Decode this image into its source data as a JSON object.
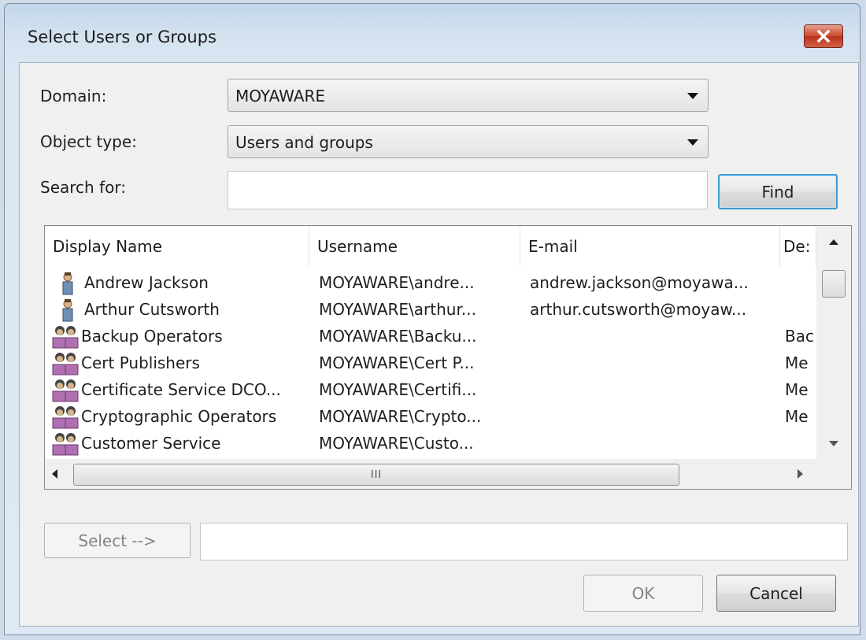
{
  "window": {
    "title": "Select Users or Groups"
  },
  "form": {
    "domain_label": "Domain:",
    "domain_value": "MOYAWARE",
    "object_type_label": "Object type:",
    "object_type_value": "Users and groups",
    "search_label": "Search for:",
    "search_value": "",
    "find_label": "Find"
  },
  "list": {
    "columns": [
      "Display Name",
      "Username",
      "E-mail",
      "De:"
    ],
    "rows": [
      {
        "icon": "user-icon",
        "name": "Andrew Jackson",
        "username": "MOYAWARE\\andre...",
        "email": "andrew.jackson@moyawa...",
        "desc": ""
      },
      {
        "icon": "user-icon",
        "name": "Arthur Cutsworth",
        "username": "MOYAWARE\\arthur...",
        "email": "arthur.cutsworth@moyaw...",
        "desc": ""
      },
      {
        "icon": "group-icon",
        "name": "Backup Operators",
        "username": "MOYAWARE\\Backu...",
        "email": "",
        "desc": "Bac"
      },
      {
        "icon": "group-icon",
        "name": "Cert Publishers",
        "username": "MOYAWARE\\Cert P...",
        "email": "",
        "desc": "Me"
      },
      {
        "icon": "group-icon",
        "name": "Certificate Service DCO...",
        "username": "MOYAWARE\\Certifi...",
        "email": "",
        "desc": "Me"
      },
      {
        "icon": "group-icon",
        "name": "Cryptographic Operators",
        "username": "MOYAWARE\\Crypto...",
        "email": "",
        "desc": "Me"
      },
      {
        "icon": "group-icon",
        "name": "Customer Service",
        "username": "MOYAWARE\\Custo...",
        "email": "",
        "desc": ""
      }
    ],
    "hscroll_grip": "III"
  },
  "footer": {
    "select_label": "Select -->",
    "selection_value": "",
    "ok_label": "OK",
    "cancel_label": "Cancel"
  },
  "colors": {
    "accent": "#3d9bd5",
    "close_red": "#c8472d",
    "user_icon": "#6f8fb6",
    "group_icon": "#b06fb0"
  }
}
